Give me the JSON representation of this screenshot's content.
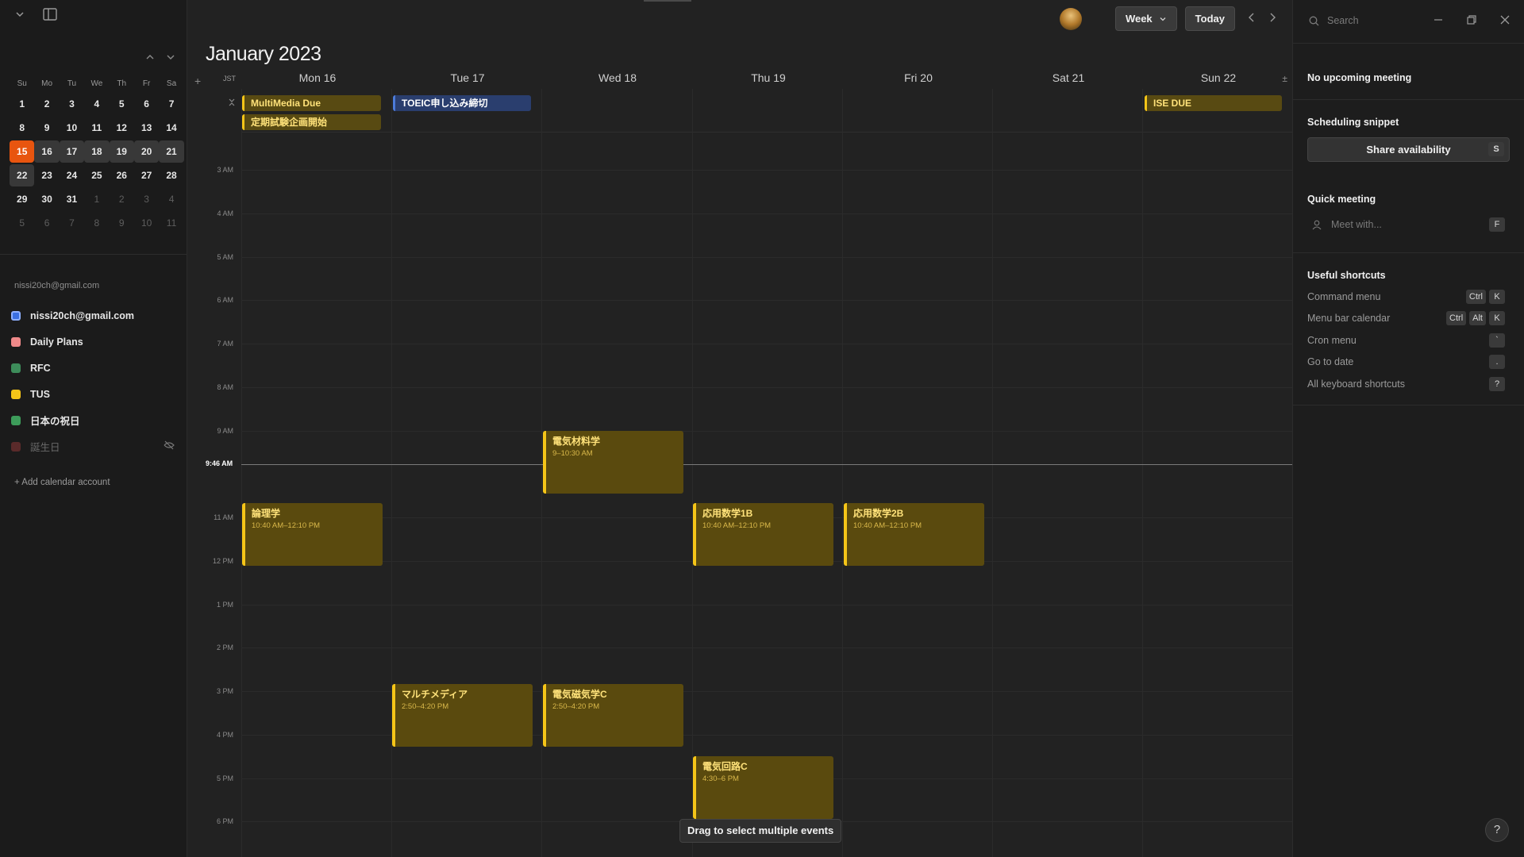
{
  "mini_calendar": {
    "dow": [
      "Su",
      "Mo",
      "Tu",
      "We",
      "Th",
      "Fr",
      "Sa"
    ],
    "weeks": [
      [
        "1",
        "2",
        "3",
        "4",
        "5",
        "6",
        "7"
      ],
      [
        "8",
        "9",
        "10",
        "11",
        "12",
        "13",
        "14"
      ],
      [
        "15",
        "16",
        "17",
        "18",
        "19",
        "20",
        "21"
      ],
      [
        "22",
        "23",
        "24",
        "25",
        "26",
        "27",
        "28"
      ],
      [
        "29",
        "30",
        "31",
        "1",
        "2",
        "3",
        "4"
      ],
      [
        "5",
        "6",
        "7",
        "8",
        "9",
        "10",
        "11"
      ]
    ],
    "today": "15"
  },
  "sidebar": {
    "account_email": "nissi20ch@gmail.com",
    "calendars": [
      {
        "label": "nissi20ch@gmail.com",
        "color": "#3b6fe0"
      },
      {
        "label": "Daily Plans",
        "color": "#f08a8a"
      },
      {
        "label": "RFC",
        "color": "#3d8c5a"
      },
      {
        "label": "TUS",
        "color": "#f5c518"
      },
      {
        "label": "日本の祝日",
        "color": "#3d9c5a"
      },
      {
        "label": "誕生日",
        "color": "#8a3535"
      }
    ],
    "add_account": "Add calendar account"
  },
  "header": {
    "view_label": "Week",
    "today_label": "Today",
    "month_title": "January 2023",
    "timezone": "JST"
  },
  "days": [
    "Mon 16",
    "Tue 17",
    "Wed 18",
    "Thu 19",
    "Fri 20",
    "Sat 21",
    "Sun 22"
  ],
  "all_day_events": [
    {
      "title": "MultiMedia Due"
    },
    {
      "title": "定期試験企画開始"
    },
    {
      "title": "TOEIC申し込み締切"
    },
    {
      "title": "ISE DUE"
    }
  ],
  "hours": [
    "3 AM",
    "4 AM",
    "5 AM",
    "6 AM",
    "7 AM",
    "8 AM",
    "9 AM",
    "11 AM",
    "12 PM",
    "1 PM",
    "2 PM",
    "3 PM",
    "4 PM",
    "5 PM",
    "6 PM"
  ],
  "now_label": "9:46 AM",
  "events": [
    {
      "title": "電気材料学",
      "time": "9–10:30 AM"
    },
    {
      "title": "論理学",
      "time": "10:40 AM–12:10 PM"
    },
    {
      "title": "応用数学1B",
      "time": "10:40 AM–12:10 PM"
    },
    {
      "title": "応用数学2B",
      "time": "10:40 AM–12:10 PM"
    },
    {
      "title": "マルチメディア",
      "time": "2:50–4:20 PM"
    },
    {
      "title": "電気磁気学C",
      "time": "2:50–4:20 PM"
    },
    {
      "title": "電気回路C",
      "time": "4:30–6 PM"
    }
  ],
  "tooltip": "Drag to select multiple events",
  "right_panel": {
    "search_placeholder": "Search",
    "no_meeting": "No upcoming meeting",
    "scheduling_title": "Scheduling snippet",
    "share_label": "Share availability",
    "share_key": "S",
    "quick_title": "Quick meeting",
    "meet_placeholder": "Meet with...",
    "meet_key": "F",
    "shortcuts_title": "Useful shortcuts",
    "shortcuts": [
      {
        "label": "Command menu",
        "keys": [
          "Ctrl",
          "K"
        ]
      },
      {
        "label": "Menu bar calendar",
        "keys": [
          "Ctrl",
          "Alt",
          "K"
        ]
      },
      {
        "label": "Cron menu",
        "keys": [
          "`"
        ]
      },
      {
        "label": "Go to date",
        "keys": [
          "."
        ]
      },
      {
        "label": "All keyboard shortcuts",
        "keys": [
          "?"
        ]
      }
    ],
    "help_label": "?"
  },
  "colors": {
    "accent_today": "#e8550f",
    "event_yellow": "#f5c518",
    "event_blue": "#4c7bd9"
  }
}
